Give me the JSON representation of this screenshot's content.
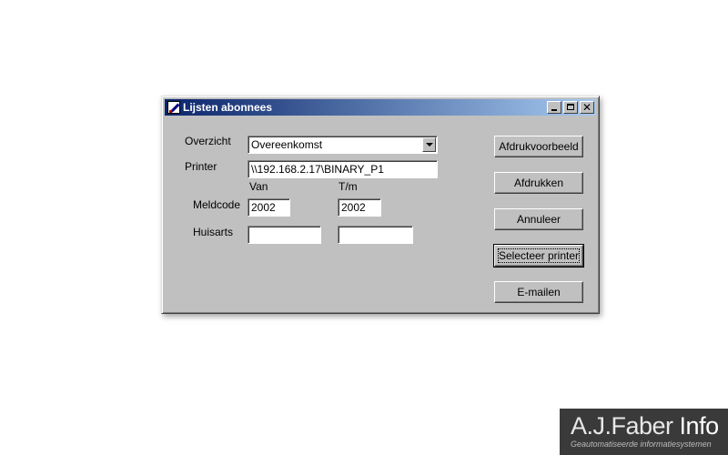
{
  "window": {
    "title": "Lijsten abonnees"
  },
  "labels": {
    "overzicht": "Overzicht",
    "printer": "Printer",
    "van": "Van",
    "tm": "T/m",
    "meldcode": "Meldcode",
    "huisarts": "Huisarts"
  },
  "fields": {
    "overzicht_value": "Overeenkomst",
    "printer_value": "\\\\192.168.2.17\\BINARY_P1",
    "meldcode_van": "2002",
    "meldcode_tm": "2002",
    "huisarts_van": "",
    "huisarts_tm": ""
  },
  "buttons": {
    "preview": "Afdrukvoorbeeld",
    "print": "Afdrukken",
    "cancel": "Annuleer",
    "select_printer": "Selecteer printer",
    "email": "E-mailen"
  },
  "brand": {
    "name_part1": "A.J.Faber ",
    "name_part2": "Info",
    "tagline": "Geautomatiseerde informatiesystemen"
  },
  "colors": {
    "titlebar_start": "#0a246a",
    "titlebar_end": "#a6caf0",
    "window_face": "#c0c0c0",
    "brand_bg": "#3a3a3a"
  }
}
